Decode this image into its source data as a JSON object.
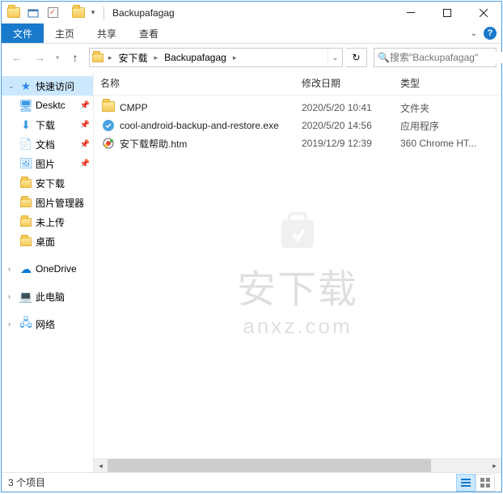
{
  "window": {
    "title": "Backupafagag"
  },
  "ribbon": {
    "file": "文件",
    "tabs": [
      "主页",
      "共享",
      "查看"
    ]
  },
  "nav": {
    "up_tooltip": "上移"
  },
  "address": {
    "segments": [
      "安下载",
      "Backupafagag"
    ]
  },
  "search": {
    "placeholder": "搜索\"Backupafagag\""
  },
  "columns": {
    "name": "名称",
    "date": "修改日期",
    "type": "类型"
  },
  "navpane": {
    "quick_access": "快速访问",
    "items": [
      {
        "label": "Desktc",
        "icon": "desktop",
        "pinned": true
      },
      {
        "label": "下载",
        "icon": "download",
        "pinned": true
      },
      {
        "label": "文档",
        "icon": "doc",
        "pinned": true
      },
      {
        "label": "图片",
        "icon": "pic",
        "pinned": true
      },
      {
        "label": "安下载",
        "icon": "folder",
        "pinned": false
      },
      {
        "label": "图片管理器",
        "icon": "folder",
        "pinned": false
      },
      {
        "label": "未上传",
        "icon": "folder",
        "pinned": false
      },
      {
        "label": "桌面",
        "icon": "folder",
        "pinned": false
      }
    ],
    "onedrive": "OneDrive",
    "thispc": "此电脑",
    "network": "网络"
  },
  "files": [
    {
      "name": "CMPP",
      "date": "2020/5/20 10:41",
      "type": "文件夹",
      "icon": "folder"
    },
    {
      "name": "cool-android-backup-and-restore.exe",
      "date": "2020/5/20 14:56",
      "type": "应用程序",
      "icon": "exe"
    },
    {
      "name": "安下载帮助.htm",
      "date": "2019/12/9 12:39",
      "type": "360 Chrome HT...",
      "icon": "htm"
    }
  ],
  "status": {
    "count": "3 个项目"
  },
  "watermark": {
    "main": "安下载",
    "sub": "anxz.com"
  }
}
